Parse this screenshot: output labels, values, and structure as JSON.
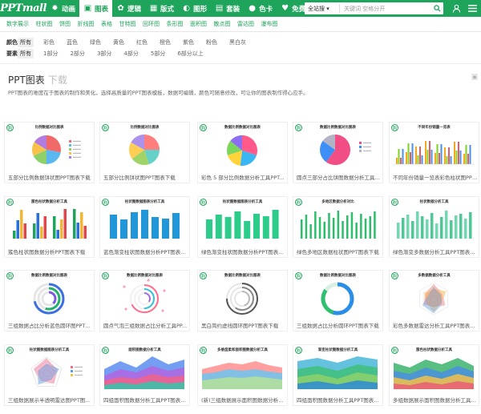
{
  "logo": "PPTmall",
  "nav": [
    {
      "label": "动画",
      "icon": "gear-icon"
    },
    {
      "label": "图表",
      "icon": "chart-icon",
      "active": true
    },
    {
      "label": "逻辑",
      "icon": "logic-icon"
    },
    {
      "label": "版式",
      "icon": "layout-icon"
    },
    {
      "label": "图形",
      "icon": "shape-icon"
    },
    {
      "label": "套装",
      "icon": "suit-icon"
    },
    {
      "label": "色卡",
      "icon": "palette-icon"
    },
    {
      "label": "免费",
      "icon": "heart-icon"
    },
    {
      "label": "会员",
      "icon": "vip-icon"
    }
  ],
  "search": {
    "scope": "全站搜 ▾",
    "placeholder": "关键词 空格分开"
  },
  "subnav": [
    "数字展示",
    "柱状图",
    "饼图",
    "折线图",
    "表格",
    "甘特图",
    "回环图",
    "条形图",
    "面积图",
    "散点图",
    "雷达图",
    "瀑布图"
  ],
  "filters": {
    "color": {
      "label": "颜色",
      "options": [
        "所有",
        "彩色",
        "蓝色",
        "绿色",
        "黄色",
        "红色",
        "橙色",
        "紫色",
        "粉色",
        "黑白灰"
      ]
    },
    "element": {
      "label": "要素",
      "options": [
        "所有",
        "1部分",
        "2部分",
        "3部分",
        "4部分",
        "5部分",
        "6部分以上"
      ]
    }
  },
  "page": {
    "title": "PPT图表",
    "title_sub": "下载",
    "description": "PPT图表的难度在于图表的制作和美化，选择高质量的PPT图表模板，数据可编辑，颜色可随意修改，可让你的图表制作得心应手。"
  },
  "badge_text": "购",
  "cards": [
    {
      "title": "五部分比例数据饼状图PPT图表下载",
      "chart_title": "比例数据对比图表",
      "kind": "pie"
    },
    {
      "title": "五部分比例饼状图PPT图表下载",
      "chart_title": "比例数据对比图表",
      "kind": "pie2"
    },
    {
      "title": "彩色 5 部分比例数据分析工具PPT...",
      "chart_title": "数据比例数据对比图表",
      "kind": "pie3"
    },
    {
      "title": "圆点三部分占比饼图数据分析工具PP...",
      "chart_title": "数据比例数据对比图表",
      "kind": "pie4"
    },
    {
      "title": "不同年份销量一览表彩色柱状图PPT...",
      "chart_title": "不同年份销量一览表",
      "kind": "bars_multi"
    },
    {
      "title": "簇色柱状图数据分析PPT图表下载",
      "chart_title": "簇色柱状数据分析工具",
      "kind": "bars_cluster"
    },
    {
      "title": "蓝色渐变柱状图数据分析PPT图表下载",
      "chart_title": "柱状图数据图表分析工具",
      "kind": "bars_blue"
    },
    {
      "title": "绿色渐变柱状图数据分析PPT图表下载",
      "chart_title": "柱状图数据图表分析工具",
      "kind": "bars_green"
    },
    {
      "title": "绿色多地区数据柱状图PPT图表下载",
      "chart_title": "多地区数据分析对比",
      "kind": "bars_thin"
    },
    {
      "title": "绿色渐变多数据分析工具PPT图表...",
      "chart_title": "柱状数据分析工具",
      "kind": "bars_grad"
    },
    {
      "title": "三组数据占比分析蓝色圆环图PPT图表...",
      "chart_title": "数据比例数据对比图表",
      "kind": "ring1"
    },
    {
      "title": "圆点气泡三组数据占比分析工具PP...",
      "chart_title": "数据比例数据对比图表",
      "kind": "ring2"
    },
    {
      "title": "黑白简约虚线圆环图PPT图表下载",
      "chart_title": "数据比例数据对比图表",
      "kind": "ring3"
    },
    {
      "title": "三组数据占比分析圆环PPT图表下载",
      "chart_title": "数据比例数据对比图表",
      "kind": "ring4"
    },
    {
      "title": "彩色多数据雷达分析工具PPT图表下载",
      "chart_title": "多数据数据分析工具",
      "kind": "radar"
    },
    {
      "title": "三组数据展示半透明雷达图PPT图表下...",
      "chart_title": "柱状图数据图表分析工具",
      "kind": "radar2"
    },
    {
      "title": "四组面积图数据分析工具PPT图表下载",
      "chart_title": "面积图数据分析工具",
      "kind": "area1"
    },
    {
      "title": "(新)三组数据展示面积图数据分析工...",
      "chart_title": "多维度柔和面积图数据分析工具",
      "kind": "area2"
    },
    {
      "title": "四组面积图数据分析工具PPT图表下载",
      "chart_title": "渐变柱状图数据分析工具",
      "kind": "area3"
    },
    {
      "title": "多组数据展示面积图数据分析工具PP...",
      "chart_title": "簇色柱状数据分析工具",
      "kind": "area4"
    }
  ],
  "colors": {
    "brand": "#1fa45c"
  }
}
